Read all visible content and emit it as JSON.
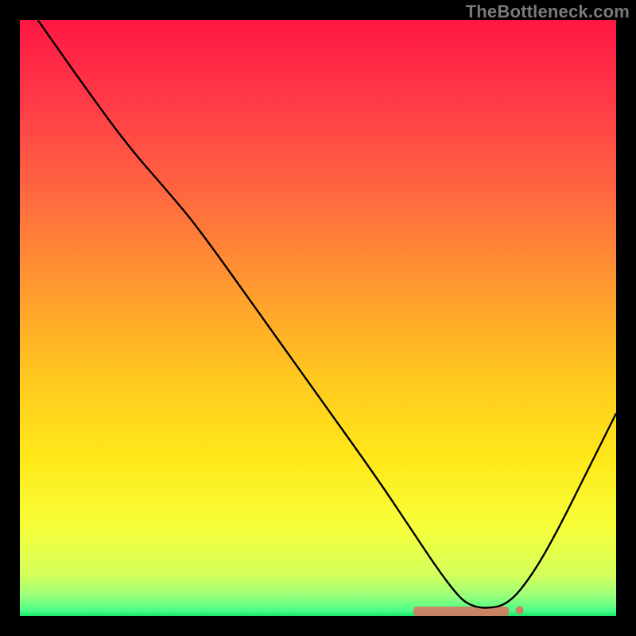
{
  "watermark": "TheBottleneck.com",
  "chart_data": {
    "type": "line",
    "title": "",
    "xlabel": "",
    "ylabel": "",
    "xlim": [
      0,
      100
    ],
    "ylim": [
      0,
      100
    ],
    "grid": false,
    "series": [
      {
        "name": "curve",
        "color": "#000000",
        "x": [
          3,
          10,
          18,
          25,
          30,
          40,
          50,
          60,
          66,
          70,
          73,
          75,
          78,
          82,
          86,
          90,
          95,
          100
        ],
        "y": [
          100,
          90,
          79,
          71,
          65,
          51,
          37,
          23,
          14,
          8,
          4,
          2,
          1.2,
          2,
          7,
          14,
          24,
          34
        ]
      }
    ],
    "highlight_band": {
      "y_from": 0,
      "y_to": 1.6,
      "x_from": 66,
      "x_to": 82,
      "color": "#e07060"
    },
    "gradient_stops": [
      {
        "offset": 0.0,
        "color": "#ff1744"
      },
      {
        "offset": 0.14,
        "color": "#ff3b47"
      },
      {
        "offset": 0.3,
        "color": "#ff6a3f"
      },
      {
        "offset": 0.45,
        "color": "#ff9a2f"
      },
      {
        "offset": 0.6,
        "color": "#ffc81f"
      },
      {
        "offset": 0.74,
        "color": "#ffe91a"
      },
      {
        "offset": 0.85,
        "color": "#f7ff3a"
      },
      {
        "offset": 0.93,
        "color": "#d4ff5a"
      },
      {
        "offset": 0.965,
        "color": "#9cff7a"
      },
      {
        "offset": 0.99,
        "color": "#4dff88"
      },
      {
        "offset": 1.0,
        "color": "#18e56a"
      }
    ]
  }
}
